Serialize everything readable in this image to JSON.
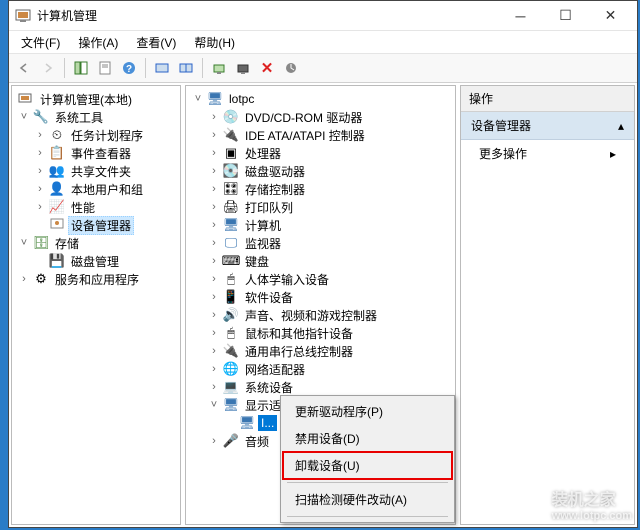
{
  "window": {
    "title": "计算机管理"
  },
  "menu": {
    "file": "文件(F)",
    "action": "操作(A)",
    "view": "查看(V)",
    "help": "帮助(H)"
  },
  "left_tree": {
    "root": "计算机管理(本地)",
    "system_tools": "系统工具",
    "task_scheduler": "任务计划程序",
    "event_viewer": "事件查看器",
    "shared_folders": "共享文件夹",
    "local_users": "本地用户和组",
    "performance": "性能",
    "device_manager": "设备管理器",
    "storage": "存储",
    "disk_mgmt": "磁盘管理",
    "services_apps": "服务和应用程序"
  },
  "mid_tree": {
    "root": "lotpc",
    "dvd": "DVD/CD-ROM 驱动器",
    "ide": "IDE ATA/ATAPI 控制器",
    "cpu": "处理器",
    "disk_drives": "磁盘驱动器",
    "storage_ctrl": "存储控制器",
    "print_queue": "打印队列",
    "computer": "计算机",
    "monitor": "监视器",
    "keyboard": "键盘",
    "hid": "人体学输入设备",
    "software_dev": "软件设备",
    "sound": "声音、视频和游戏控制器",
    "mouse": "鼠标和其他指针设备",
    "usb": "通用串行总线控制器",
    "network": "网络适配器",
    "system_dev": "系统设备",
    "display": "显示适配器",
    "display_item": "I...",
    "audio": "音频"
  },
  "actions": {
    "header": "操作",
    "selected": "设备管理器",
    "more": "更多操作"
  },
  "context": {
    "update": "更新驱动程序(P)",
    "disable": "禁用设备(D)",
    "uninstall": "卸载设备(U)",
    "scan": "扫描检测硬件改动(A)"
  },
  "watermark": {
    "name": "装机之家",
    "url": "www.lotpc.com"
  }
}
